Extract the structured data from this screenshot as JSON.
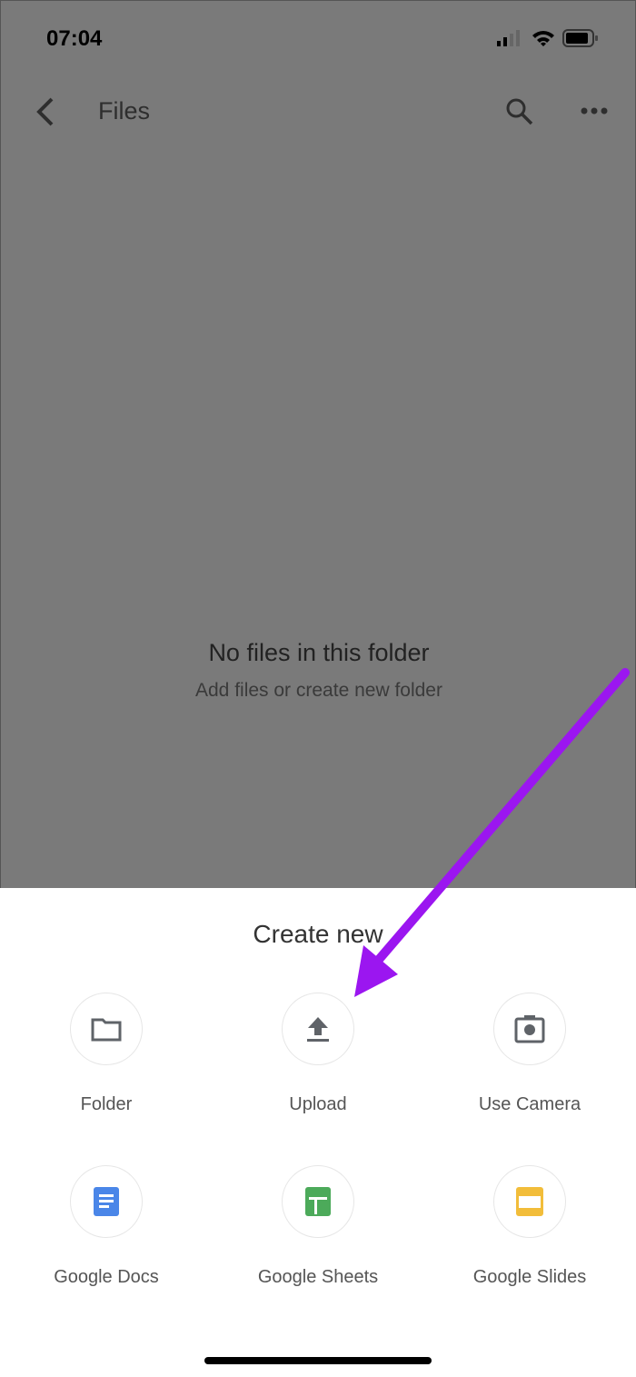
{
  "status_bar": {
    "time": "07:04",
    "icons": [
      "cellular-signal-icon",
      "wifi-icon",
      "battery-icon"
    ]
  },
  "header": {
    "title": "Files",
    "icons": [
      "back-icon",
      "search-icon",
      "more-icon"
    ]
  },
  "empty_state": {
    "title": "No files in this folder",
    "subtitle": "Add files or create new folder"
  },
  "sheet": {
    "title": "Create new",
    "options": [
      {
        "label": "Folder",
        "icon": "folder-icon"
      },
      {
        "label": "Upload",
        "icon": "upload-icon"
      },
      {
        "label": "Use Camera",
        "icon": "camera-icon"
      },
      {
        "label": "Google Docs",
        "icon": "google-docs-icon",
        "color": "#4a86e8"
      },
      {
        "label": "Google Sheets",
        "icon": "google-sheets-icon",
        "color": "#4caa5a"
      },
      {
        "label": "Google Slides",
        "icon": "google-slides-icon",
        "color": "#f2bd3a"
      }
    ]
  },
  "annotation": {
    "arrow_color": "#9b16f0",
    "points_to": "Upload"
  }
}
